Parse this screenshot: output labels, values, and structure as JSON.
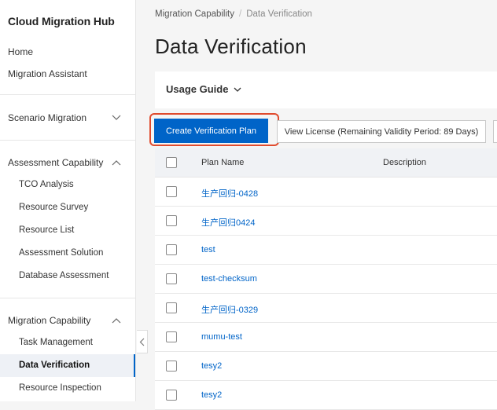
{
  "sidebar": {
    "title": "Cloud Migration Hub",
    "top_links": [
      "Home",
      "Migration Assistant"
    ],
    "groups": [
      {
        "label": "Scenario Migration",
        "expanded": false,
        "items": []
      },
      {
        "label": "Assessment Capability",
        "expanded": true,
        "items": [
          "TCO Analysis",
          "Resource Survey",
          "Resource List",
          "Assessment Solution",
          "Database Assessment"
        ]
      },
      {
        "label": "Migration Capability",
        "expanded": true,
        "items": [
          "Task Management",
          "Data Verification",
          "Resource Inspection"
        ]
      }
    ],
    "active_item": "Data Verification"
  },
  "breadcrumb": {
    "parent": "Migration Capability",
    "separator": "/",
    "current": "Data Verification"
  },
  "page": {
    "title": "Data Verification"
  },
  "usage_guide": {
    "label": "Usage Guide"
  },
  "toolbar": {
    "create_label": "Create Verification Plan",
    "license_label": "View License (Remaining Validity Period: 89 Days)"
  },
  "table": {
    "headers": {
      "name": "Plan Name",
      "description": "Description"
    },
    "rows": [
      {
        "name": "生产回归-0428"
      },
      {
        "name": "生产回归0424"
      },
      {
        "name": "test"
      },
      {
        "name": "test-checksum"
      },
      {
        "name": "生产回归-0329"
      },
      {
        "name": "mumu-test"
      },
      {
        "name": "tesy2"
      },
      {
        "name": "tesy2"
      }
    ]
  },
  "colors": {
    "accent": "#0064c8",
    "highlight": "#e04b2e"
  }
}
